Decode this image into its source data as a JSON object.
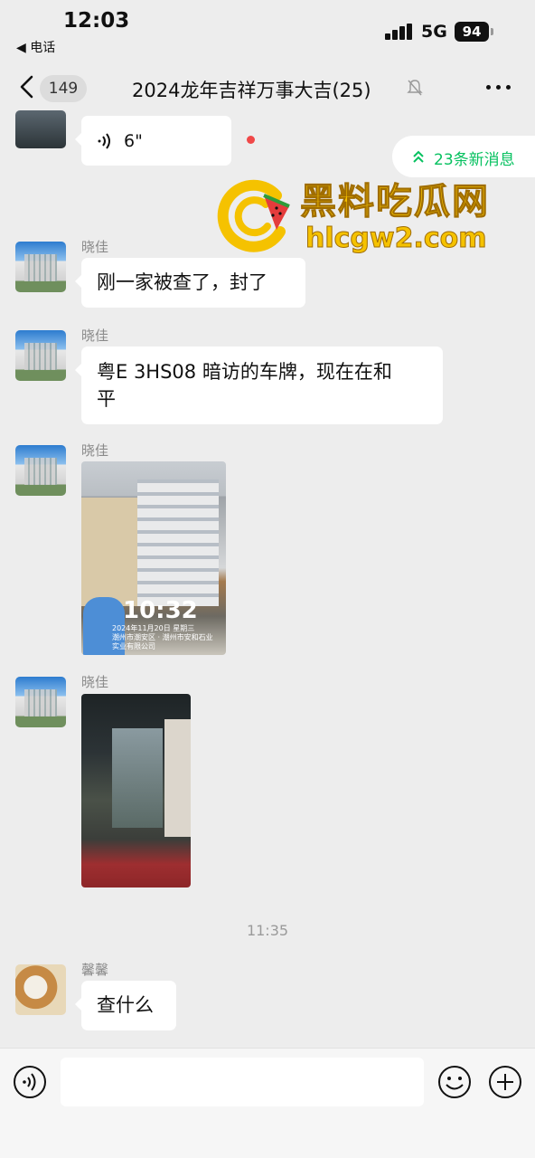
{
  "status_bar": {
    "time": "12:03",
    "back_to_app": "◀ 电话",
    "network": "5G",
    "battery": "94"
  },
  "nav": {
    "unread_count": "149",
    "title": "2024龙年吉祥万事大吉(25)"
  },
  "new_messages_pill": "23条新消息",
  "watermark": {
    "title": "黑料吃瓜网",
    "url": "hlcgw2.com"
  },
  "messages": [
    {
      "type": "voice",
      "duration": "6\""
    },
    {
      "type": "text",
      "sender": "晓佳",
      "text": "刚一家被查了，封了"
    },
    {
      "type": "text",
      "sender": "晓佳",
      "text_line1": "粤E 3HS08 暗访的车牌，现在在和",
      "text_line2": "平"
    },
    {
      "type": "image",
      "sender": "晓佳",
      "photo_time": "10:32",
      "photo_caption_1": "2024年11月20日 星期三",
      "photo_caption_2": "潮州市潮安区 · 潮州市安和石业",
      "photo_caption_3": "实业有限公司"
    },
    {
      "type": "image",
      "sender": "晓佳"
    },
    {
      "type": "timestamp",
      "text": "11:35"
    },
    {
      "type": "text",
      "sender": "馨馨",
      "text": "查什么"
    }
  ],
  "input": {
    "value": "",
    "placeholder": ""
  },
  "colors": {
    "background": "#ededed",
    "accent_green": "#07c160",
    "watermark_yellow": "#f5c200",
    "unread_dot": "#f04848"
  }
}
